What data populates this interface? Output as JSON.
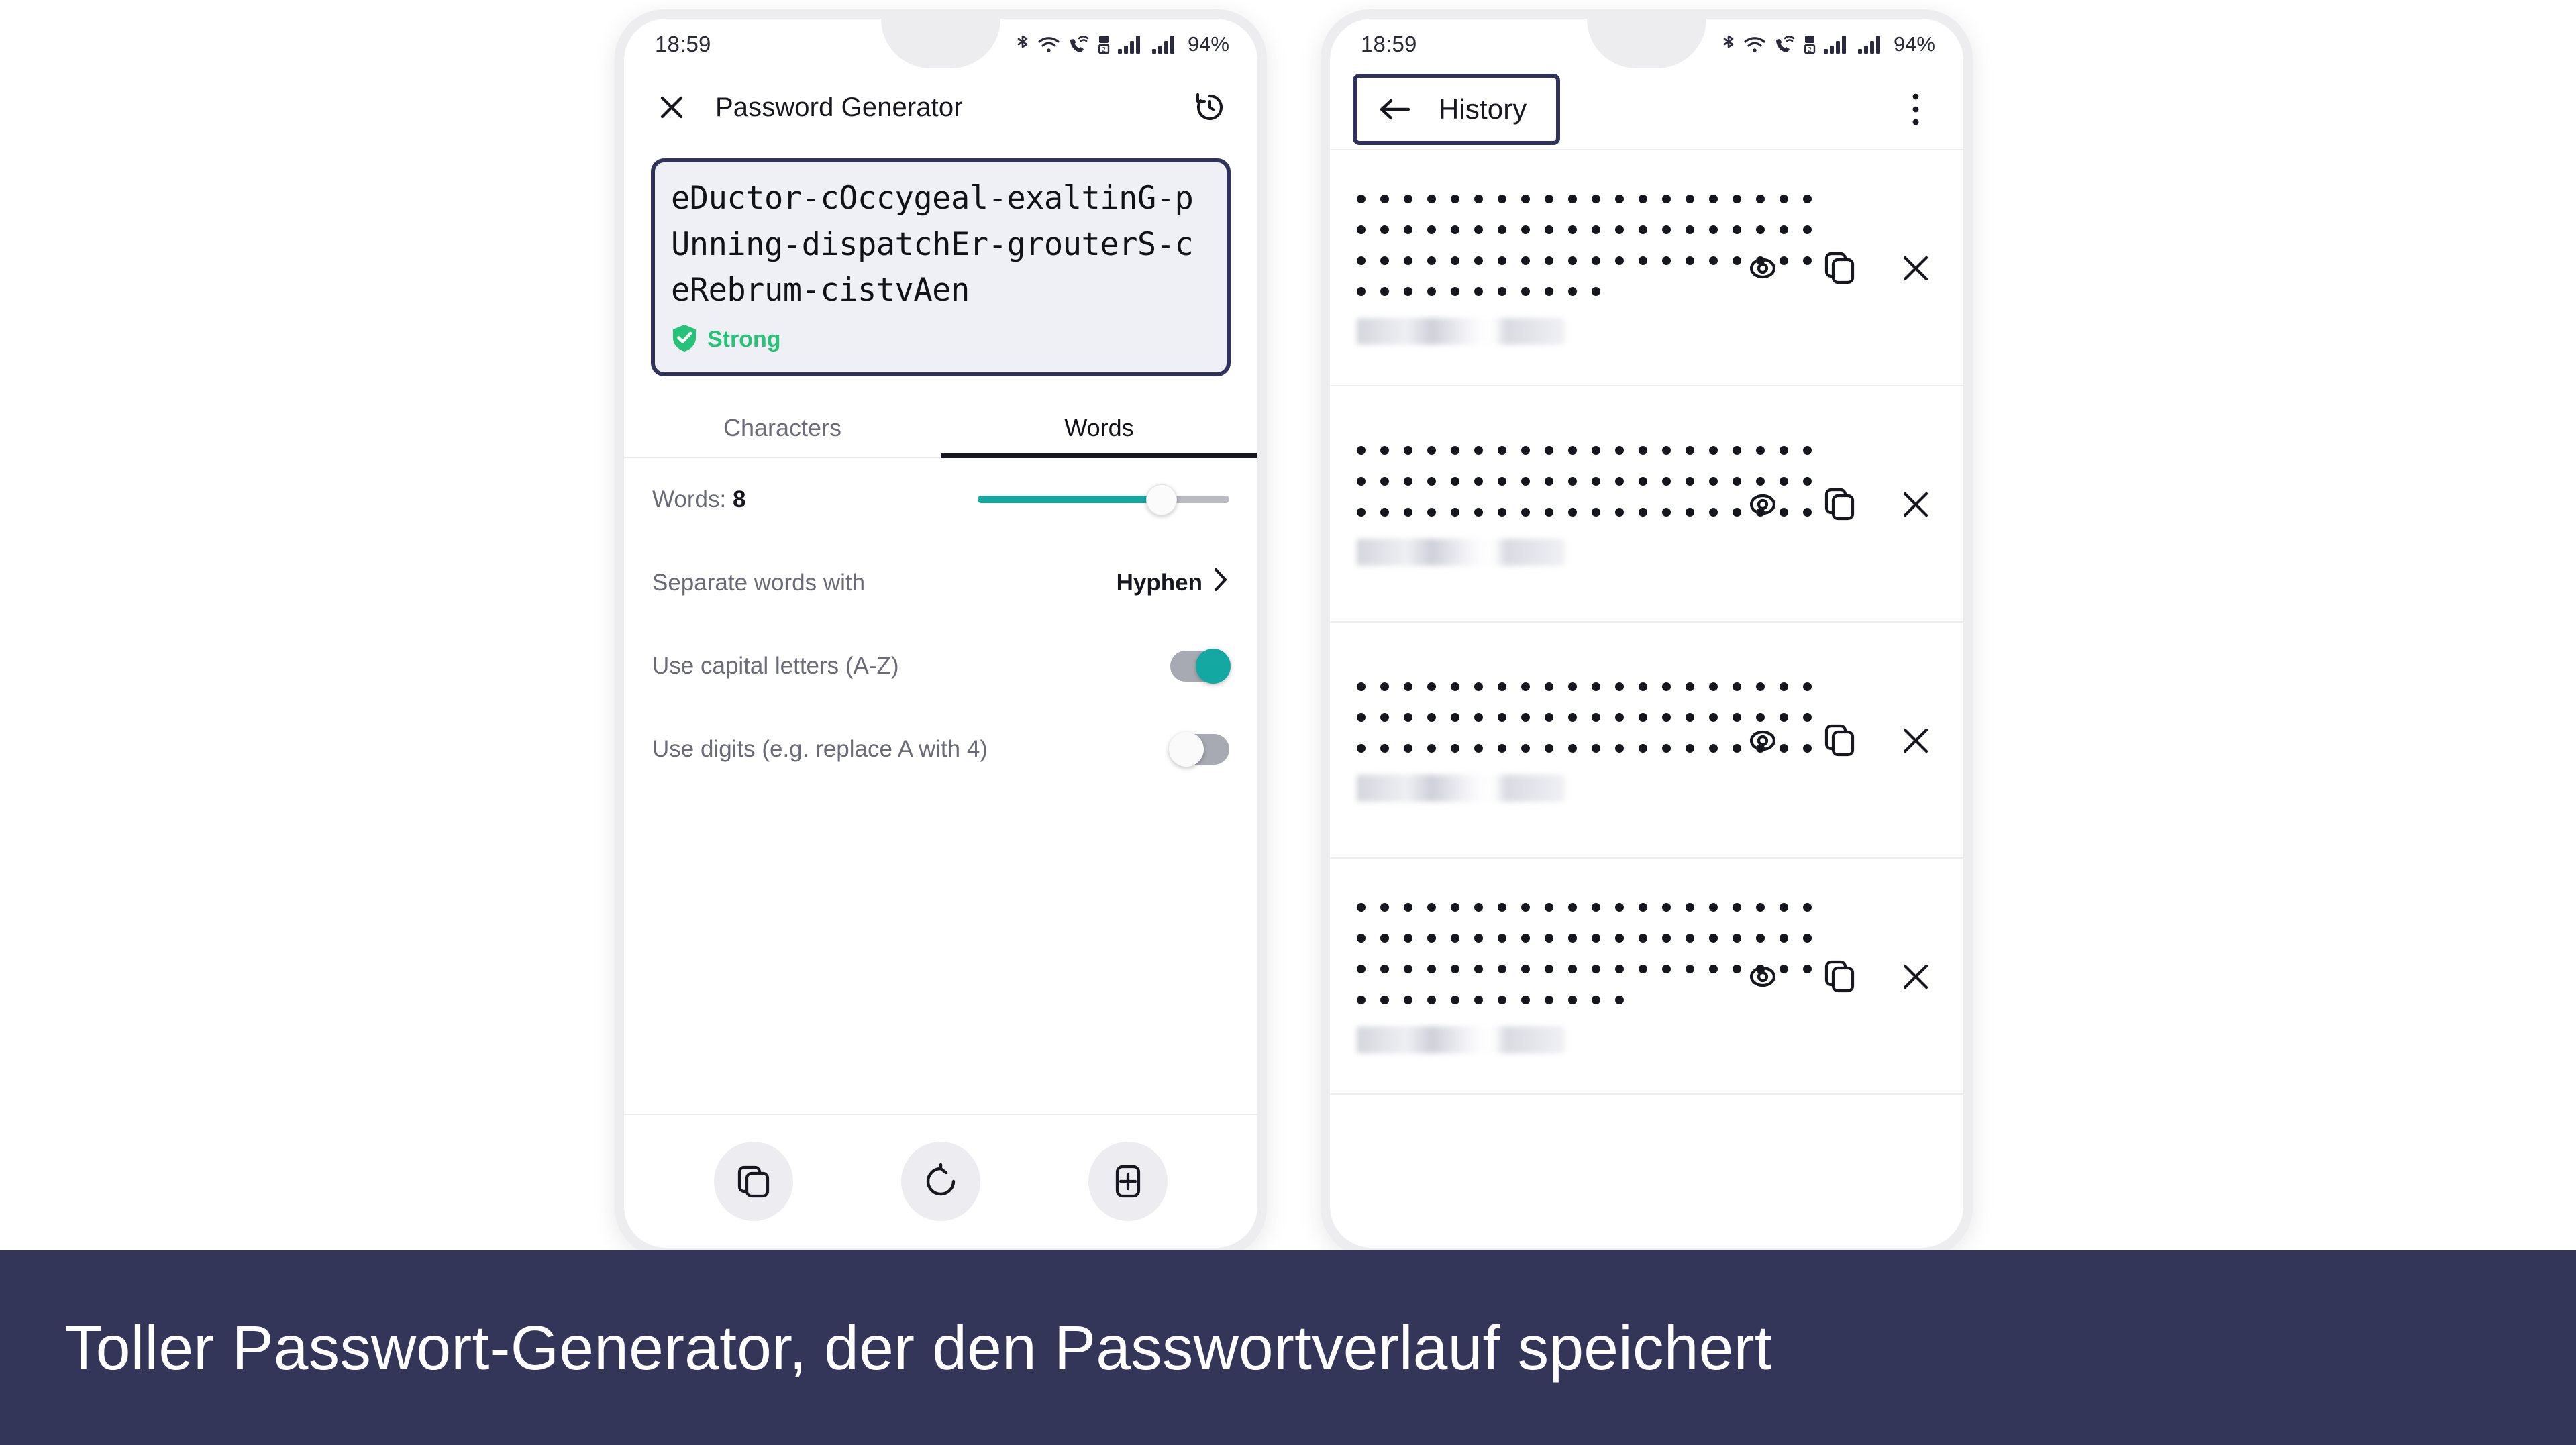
{
  "colors": {
    "accent_teal": "#14a8a2",
    "navy_highlight": "#30325c",
    "caption_bg": "#333659",
    "strong_green": "#25c277",
    "frame_gray": "#edecee"
  },
  "status_bar": {
    "time": "18:59",
    "battery": "94%",
    "icons": [
      "bluetooth-icon",
      "wifi-icon",
      "vowifi-call-icon",
      "dual-sim-icon",
      "signal-bars-1-icon",
      "signal-bars-2-icon"
    ]
  },
  "generator": {
    "close_label": "✕",
    "title": "Password Generator",
    "history_icon_name": "history-clock-icon",
    "password": "eDuctor-cOccygeal-exaltinG-pUnning-dispatchEr-grouterS-ceRebrum-cistvAen",
    "strength_label": "Strong",
    "tabs": [
      {
        "label": "Characters",
        "active": false
      },
      {
        "label": "Words",
        "active": true
      }
    ],
    "settings": {
      "words_label": "Words:",
      "words_value": "8",
      "words_slider_percent": 73,
      "separator_label": "Separate words with",
      "separator_value": "Hyphen",
      "capitals_label": "Use capital letters (A-Z)",
      "capitals_on": true,
      "digits_label": "Use digits (e.g. replace A with 4)",
      "digits_on": false
    },
    "actions": [
      {
        "name": "copy-password-button",
        "icon": "copy-icon"
      },
      {
        "name": "regenerate-password-button",
        "icon": "refresh-icon"
      },
      {
        "name": "save-password-button",
        "icon": "add-box-icon"
      }
    ]
  },
  "history": {
    "back_label": "←",
    "title": "History",
    "overflow_icon_name": "more-vertical-icon",
    "row_actions": [
      {
        "name": "reveal-password-button",
        "icon": "eye-icon"
      },
      {
        "name": "copy-password-button",
        "icon": "copy-icon"
      },
      {
        "name": "delete-password-button",
        "icon": "close-x-icon"
      }
    ],
    "items": [
      {
        "masked_lines": [
          20,
          20,
          20,
          11
        ],
        "meta_hidden": true
      },
      {
        "masked_lines": [
          20,
          20,
          20
        ],
        "meta_hidden": true
      },
      {
        "masked_lines": [
          20,
          20,
          20
        ],
        "meta_hidden": true
      },
      {
        "masked_lines": [
          20,
          20,
          20,
          12
        ],
        "meta_hidden": true
      },
      {
        "masked_lines": [],
        "meta_hidden": true
      }
    ]
  },
  "caption": {
    "text": "Toller Passwort-Generator, der den Passwortverlauf speichert"
  }
}
